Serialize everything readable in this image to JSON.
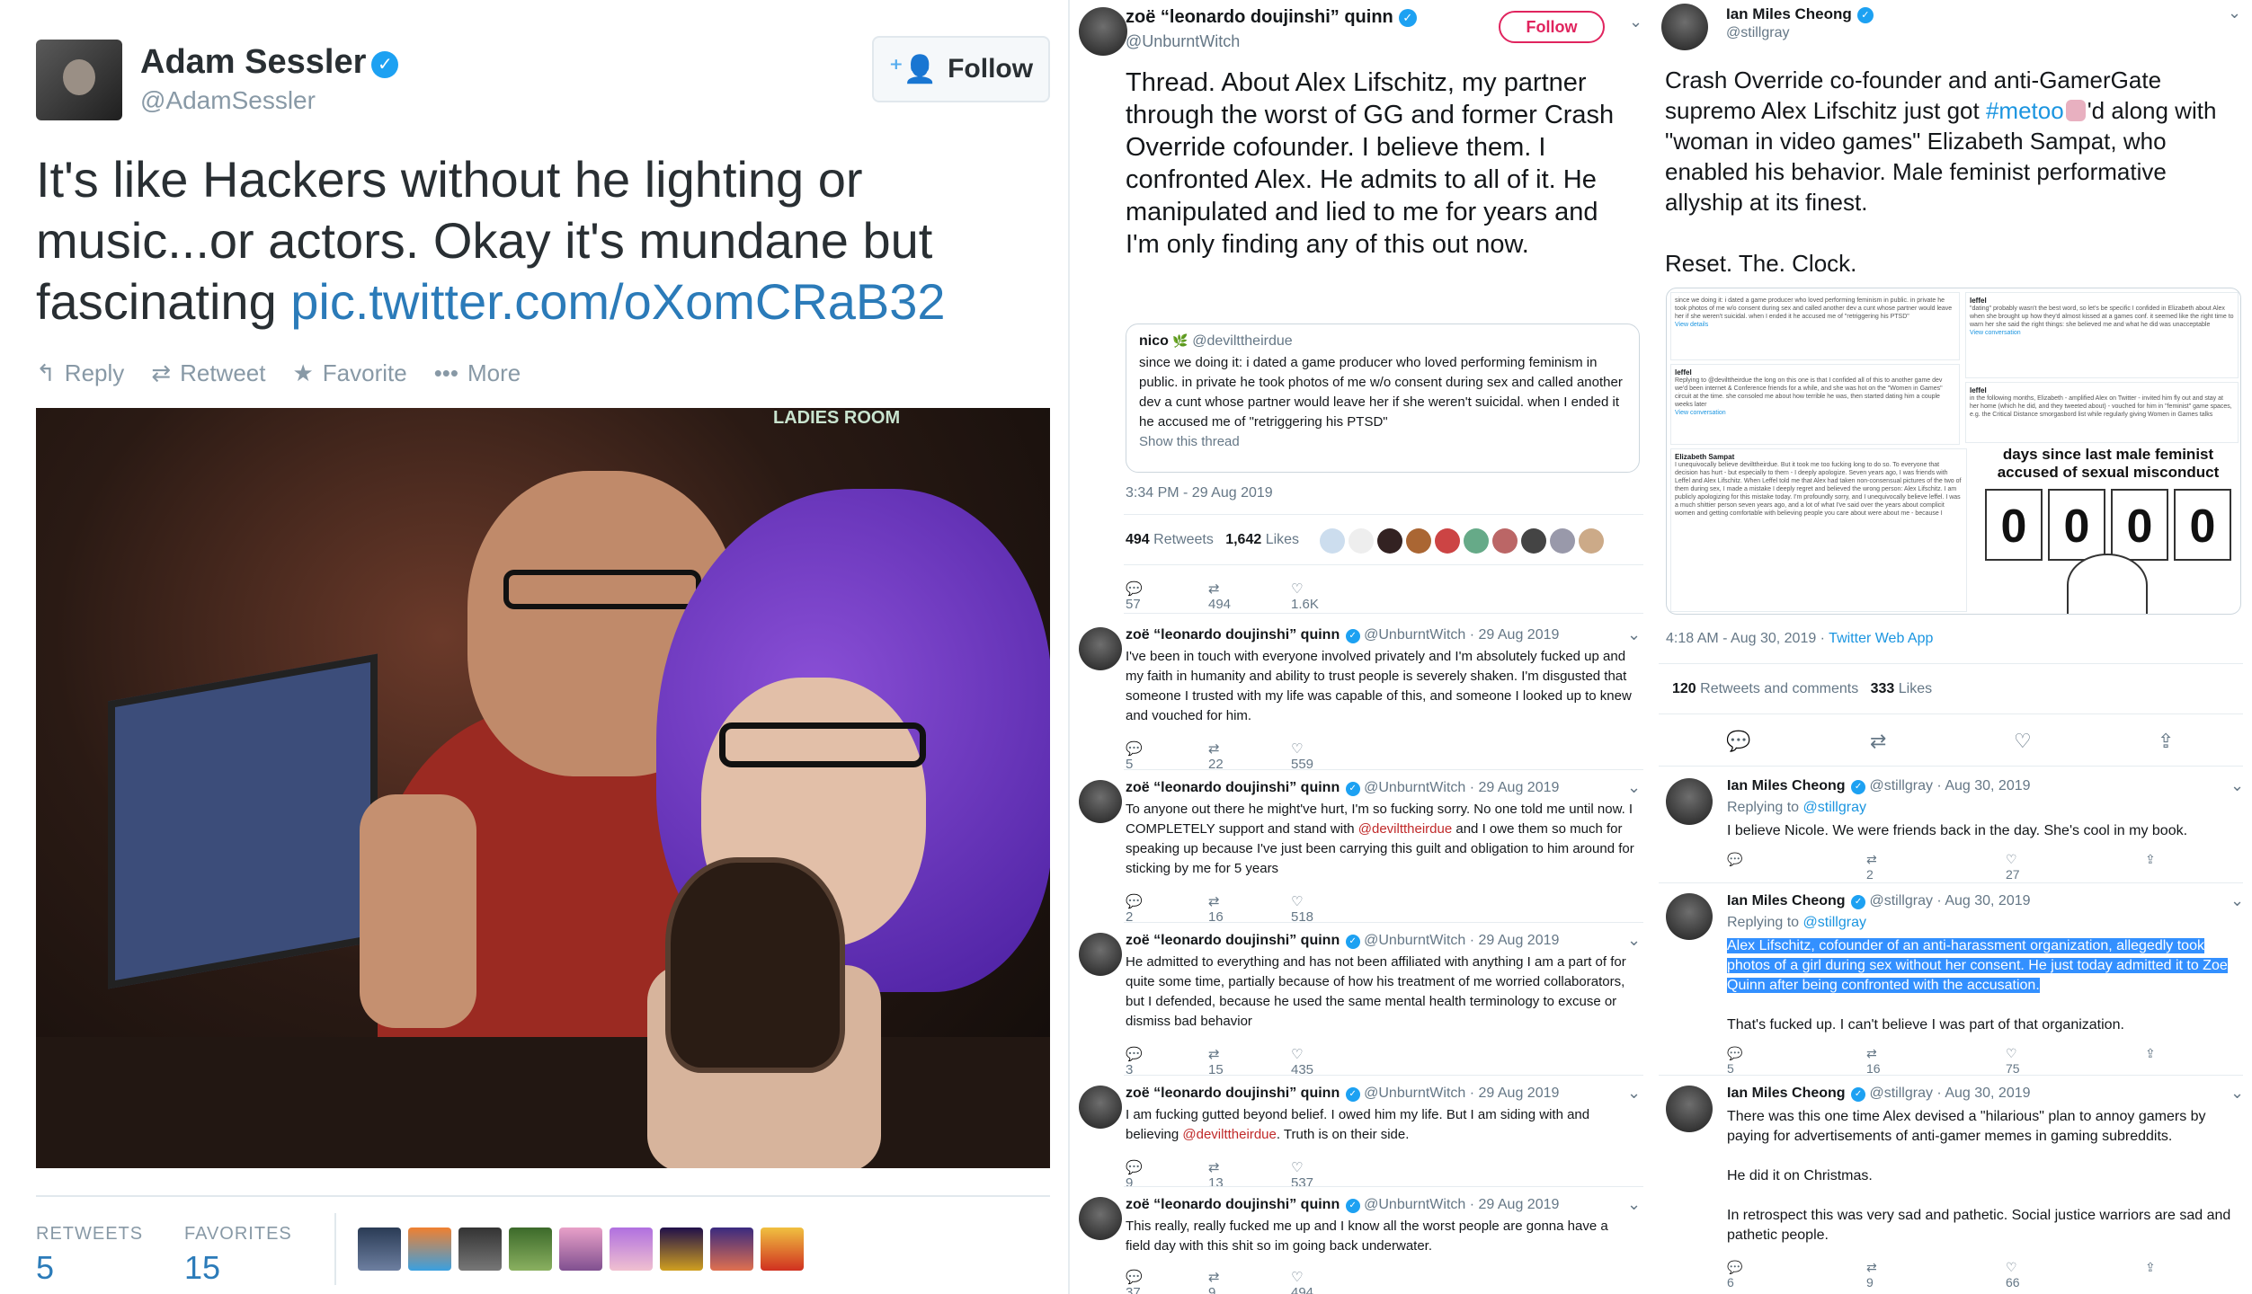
{
  "panel1": {
    "name": "Adam Sessler",
    "handle": "@AdamSessler",
    "follow_label": "Follow",
    "text": "It's like Hackers without he lighting or music...or actors.  Okay it's mundane but fascinating ",
    "link": "pic.twitter.com/oXomCRaB32",
    "actions": {
      "reply": "Reply",
      "retweet": "Retweet",
      "favorite": "Favorite",
      "more": "More"
    },
    "photo_sign": "LADIES ROOM",
    "retweets_label": "RETWEETS",
    "retweets": "5",
    "favorites_label": "FAVORITES",
    "favorites": "15"
  },
  "panel2": {
    "name": "zoë “leonardo doujinshi” quinn",
    "handle": "@UnburntWitch",
    "follow_label": "Follow",
    "text": "Thread. About Alex Lifschitz, my partner through the worst of GG and former Crash Override cofounder. I believe them. I confronted Alex. He admits to all of it. He manipulated and lied to me for years and I'm only finding any of this out now.",
    "quote": {
      "name": "nico",
      "handle": "@devilttheirdue",
      "text": "since we doing it: i dated a game producer who loved performing feminism in public. in private he took photos of me w/o consent during sex and called another dev a cunt whose partner would leave her if she weren't suicidal. when I ended it he accused me of \"retriggering his PTSD\"",
      "show_thread": "Show this thread"
    },
    "timestamp": "3:34 PM - 29 Aug 2019",
    "retweets": "494",
    "retweets_label": "Retweets",
    "likes": "1,642",
    "likes_label": "Likes",
    "main_actions": {
      "reply": "57",
      "retweet": "494",
      "like": "1.6K"
    },
    "replies": [
      {
        "name": "zoë “leonardo doujinshi” quinn",
        "handle": "@UnburntWitch",
        "date": "29 Aug 2019",
        "text": "I've been in touch with everyone involved privately and I'm absolutely fucked up and my faith in humanity and ability to trust people is severely shaken. I'm disgusted that someone I trusted with my life was capable of this, and someone I looked up to knew and vouched for him.",
        "reply": "5",
        "retweet": "22",
        "like": "559"
      },
      {
        "name": "zoë “leonardo doujinshi” quinn",
        "handle": "@UnburntWitch",
        "date": "29 Aug 2019",
        "text_a": "To anyone out there he might've hurt, I'm so fucking sorry. No one told me until now. I COMPLETELY support and stand with ",
        "mention": "@devilttheirdue",
        "text_b": " and I owe them so much for speaking up because I've just been carrying this guilt and obligation to him around for sticking by me for 5 years",
        "reply": "2",
        "retweet": "16",
        "like": "518"
      },
      {
        "name": "zoë “leonardo doujinshi” quinn",
        "handle": "@UnburntWitch",
        "date": "29 Aug 2019",
        "text": "He admitted to everything and has not been affiliated with anything I am a part of for quite some time, partially because of how his treatment of me worried collaborators, but I defended, because he used the same mental health terminology to excuse or dismiss bad behavior",
        "reply": "3",
        "retweet": "15",
        "like": "435"
      },
      {
        "name": "zoë “leonardo doujinshi” quinn",
        "handle": "@UnburntWitch",
        "date": "29 Aug 2019",
        "text_a": "I am fucking gutted beyond belief. I owed him my life. But I am siding with and believing ",
        "mention": "@devilttheirdue",
        "text_b": ". Truth is on their side.",
        "reply": "9",
        "retweet": "13",
        "like": "537"
      },
      {
        "name": "zoë “leonardo doujinshi” quinn",
        "handle": "@UnburntWitch",
        "date": "29 Aug 2019",
        "text": "This really, really fucked me up and I know all the worst people are gonna have a field day with this shit so im going back underwater.",
        "reply": "37",
        "retweet": "9",
        "like": "494"
      }
    ]
  },
  "panel3": {
    "name": "Ian Miles Cheong",
    "handle": "@stillgray",
    "text_a": "Crash Override co-founder and anti-GamerGate supremo Alex Lifschitz just got ",
    "hashtag": "#metoo",
    "text_b": "'d along with \"woman in video games\" Elizabeth Sampat, who enabled his behavior. Male feminist performative allyship at its finest.",
    "text_c": "Reset. The. Clock.",
    "image": {
      "counter_title": "days since last male feminist accused of sexual misconduct",
      "digits": [
        "0",
        "0",
        "0",
        "0"
      ],
      "mini1_text": "since we doing it: i dated a game producer who loved performing feminism in public. in private he took photos of me w/o consent during sex and called another dev a cunt whose partner would leave her if she weren't suicidal. when I ended it he accused me of \"retriggering his PTSD\"",
      "mini1_link": "View details",
      "mini2_name": "leffel",
      "mini2_text": "\"dating\" probably wasn't the best word, so let's be specific I confided in Elizabeth about Alex when she brought up how they'd almost kissed at a games conf. it seemed like the right time to warn her she said the right things: she believed me and what he did was unacceptable",
      "mini2_link": "View conversation",
      "mini3_name": "leffel",
      "mini3_text": "Replying to @devilttheirdue the long on this one is that I confided all of this to another game dev we'd been internet & Conference friends for a while, and she was hot on the \"Women in Games\" circuit at the time. she consoled me about how terrible he was, then started dating him a couple weeks later",
      "mini3_link": "View conversation",
      "mini4_name": "leffel",
      "mini4_text": "in the following months, Elizabeth - amplified Alex on Twitter - invited him fly out and stay at her home (which he did, and they tweeted about) - vouched for him in \"feminist\" game spaces, e.g. the Critical Distance smorgasbord list while regularly giving Women in Games talks",
      "mini5_name": "Elizabeth Sampat",
      "mini5_text": "I unequivocally believe devilttheirdue. But it took me too fucking long to do so. To everyone that decision has hurt - but especially to them - I deeply apologize. Seven years ago, I was friends with Leffel and Alex Lifschitz. When Leffel told me that Alex had taken non-consensual pictures of the two of them during sex, I made a mistake I deeply regret and believed the wrong person: Alex Lifschitz. I am publicly apologizing for this mistake today. I'm profoundly sorry, and I unequivocally believe leffel. I was a much shittier person seven years ago, and a lot of what I've said over the years about complicit women and getting comfortable with believing people you care about were about me - because I"
    },
    "timestamp": "4:18 AM - Aug 30, 2019",
    "app": "Twitter Web App",
    "retweets": "120",
    "retweets_label": "Retweets and comments",
    "likes": "333",
    "likes_label": "Likes",
    "replies": [
      {
        "name": "Ian Miles Cheong",
        "handle": "@stillgray",
        "date": "Aug 30, 2019",
        "replying_label": "Replying to",
        "replying_to": "@stillgray",
        "text": "I believe Nicole. We were friends back in the day. She's cool in my book.",
        "reply": "",
        "retweet": "2",
        "like": "27"
      },
      {
        "name": "Ian Miles Cheong",
        "handle": "@stillgray",
        "date": "Aug 30, 2019",
        "replying_label": "Replying to",
        "replying_to": "@stillgray",
        "text_hl": "Alex Lifschitz, cofounder of an anti-harassment organization, allegedly took photos of a girl during sex without her consent. He just today admitted it to Zoe Quinn after being confronted with the accusation.",
        "text": "That's fucked up. I can't believe I was part of that organization.",
        "reply": "5",
        "retweet": "16",
        "like": "75"
      },
      {
        "name": "Ian Miles Cheong",
        "handle": "@stillgray",
        "date": "Aug 30, 2019",
        "text_1": "There was this one time Alex devised a \"hilarious\" plan to annoy gamers by paying for advertisements of anti-gamer memes in gaming subreddits.",
        "text_2": "He did it on Christmas.",
        "text_3": "In retrospect this was very sad and pathetic. Social justice warriors are sad and pathetic people.",
        "reply": "6",
        "retweet": "9",
        "like": "66"
      }
    ]
  }
}
